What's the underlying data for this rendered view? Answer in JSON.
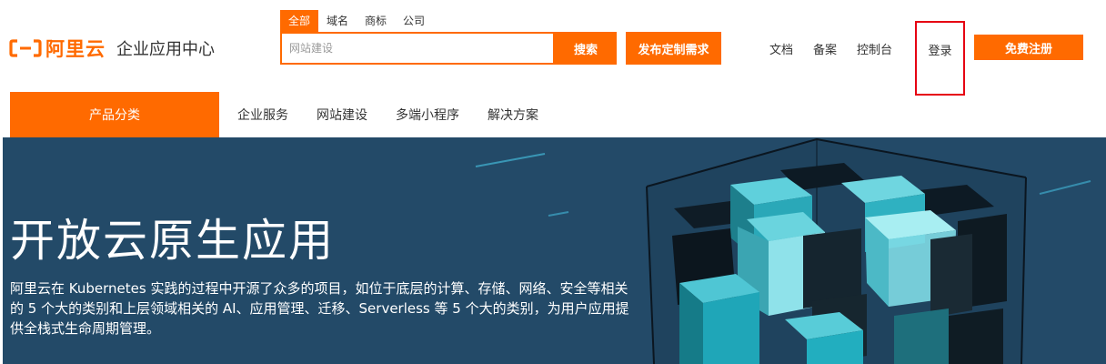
{
  "header": {
    "logo_text": "阿里云",
    "logo_subtitle": "企业应用中心",
    "search_tabs": [
      "全部",
      "域名",
      "商标",
      "公司"
    ],
    "search_placeholder": "网站建设",
    "search_button": "搜索",
    "demand_button": "发布定制需求",
    "links": [
      "文档",
      "备案",
      "控制台"
    ],
    "login": "登录",
    "register_button": "免费注册"
  },
  "nav": {
    "category_button": "产品分类",
    "items": [
      "企业服务",
      "网站建设",
      "多端小程序",
      "解决方案"
    ]
  },
  "banner": {
    "title": "开放云原生应用",
    "description": "阿里云在 Kubernetes 实践的过程中开源了众多的项目，如位于底层的计算、存储、网络、安全等相关的 5 个大的类别和上层领域相关的 AI、应用管理、迁移、Serverless 等 5 个大的类别，为用户应用提供全栈式生命周期管理。"
  },
  "colors": {
    "brand_orange": "#ff6a00",
    "banner_bg": "#234a68",
    "highlight_red": "#e60012"
  }
}
